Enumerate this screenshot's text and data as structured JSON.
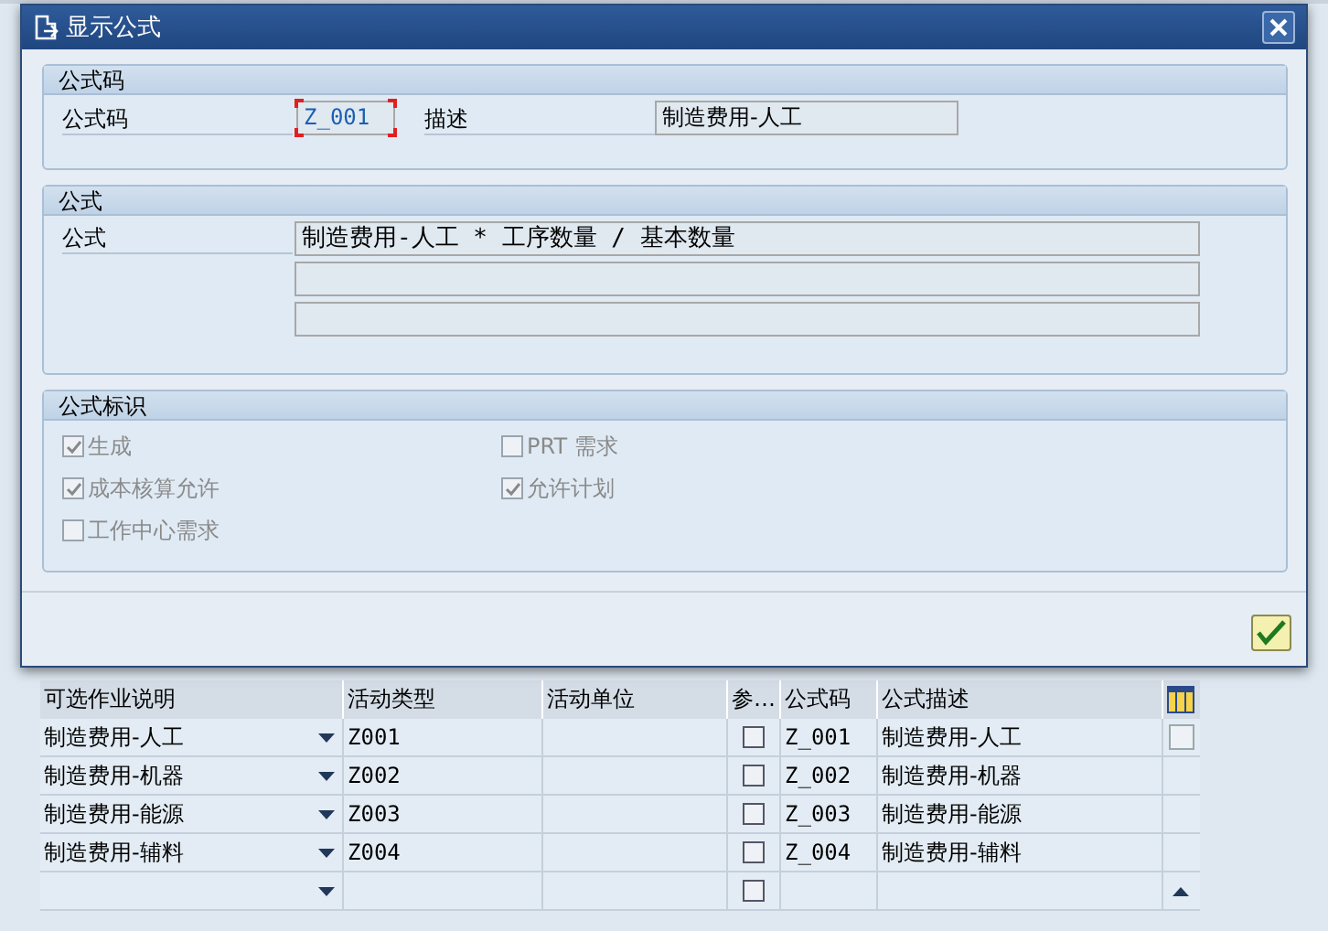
{
  "dialog": {
    "title": "显示公式",
    "code_group": {
      "title": "公式码",
      "code_label": "公式码",
      "code_value": "Z_001",
      "code_focused": true,
      "desc_label": "描述",
      "desc_value": "制造费用-人工"
    },
    "formula_group": {
      "title": "公式",
      "label": "公式",
      "lines": [
        {
          "kind": "text",
          "text": "制造费用-人工 * 工序数量 / 基本数量"
        },
        {
          "kind": "blank"
        },
        {
          "kind": "blank"
        }
      ]
    },
    "flags_group": {
      "title": "公式标识",
      "disabled": true,
      "flags": [
        {
          "label": "生成",
          "checked": true
        },
        {
          "label": "PRT 需求",
          "checked": false
        },
        {
          "label": "成本核算允许",
          "checked": true
        },
        {
          "label": "允许计划",
          "checked": true
        },
        {
          "label": "工作中心需求",
          "checked": false
        }
      ]
    }
  },
  "table": {
    "columns": [
      "可选作业说明",
      "活动类型",
      "活动单位",
      "参…",
      "公式码",
      "公式描述"
    ],
    "rows": [
      {
        "description": "制造费用-人工",
        "activity_type": "Z001",
        "flag": false,
        "code": "Z_001",
        "code_desc": "制造费用-人工"
      },
      {
        "description": "制造费用-机器",
        "activity_type": "Z002",
        "flag": false,
        "code": "Z_002",
        "code_desc": "制造费用-机器"
      },
      {
        "description": "制造费用-能源",
        "activity_type": "Z003",
        "flag": false,
        "code": "Z_003",
        "code_desc": "制造费用-能源"
      },
      {
        "description": "制造费用-辅料",
        "activity_type": "Z004",
        "flag": false,
        "code": "Z_004",
        "code_desc": "制造费用-辅料"
      },
      {
        "description": "",
        "activity_type": "",
        "flag": false,
        "code": "",
        "code_desc": ""
      }
    ]
  }
}
